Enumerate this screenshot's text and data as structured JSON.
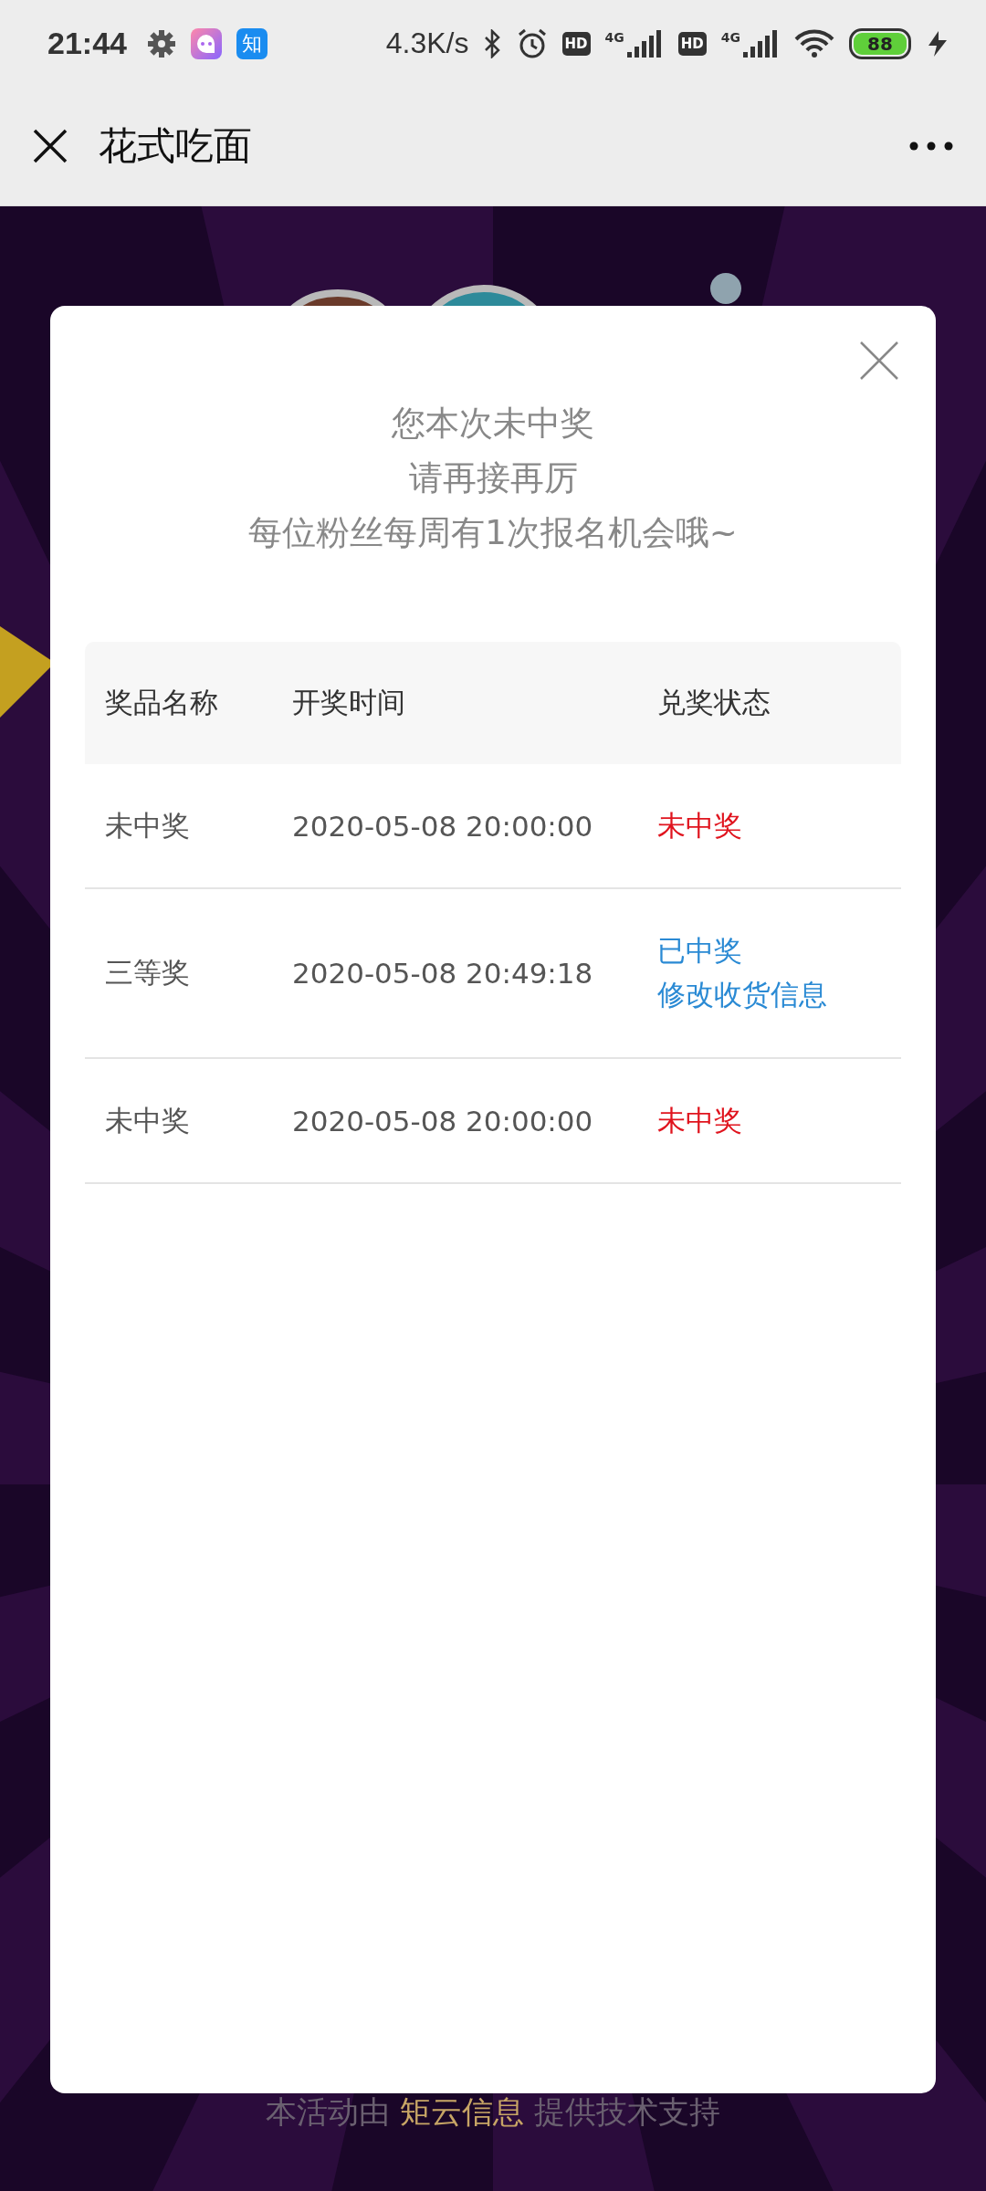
{
  "status_bar": {
    "time": "21:44",
    "app_badge": "知",
    "net_speed": "4.3K/s",
    "sims": [
      {
        "hd": "HD",
        "network": "4G"
      },
      {
        "hd": "HD",
        "network": "4G"
      }
    ],
    "battery": "88"
  },
  "header": {
    "title": "花式吃面"
  },
  "dialog": {
    "messages": [
      "您本次未中奖",
      "请再接再厉",
      "每位粉丝每周有1次报名机会哦~"
    ],
    "table": {
      "columns": [
        "奖品名称",
        "开奖时间",
        "兑奖状态"
      ],
      "rows": [
        {
          "prize": "未中奖",
          "time": "2020-05-08 20:00:00",
          "status": "未中奖",
          "kind": "lost"
        },
        {
          "prize": "三等奖",
          "time": "2020-05-08 20:49:18",
          "status": "已中奖",
          "link": "修改收货信息",
          "kind": "won"
        },
        {
          "prize": "未中奖",
          "time": "2020-05-08 20:00:00",
          "status": "未中奖",
          "kind": "lost"
        }
      ]
    }
  },
  "footer": {
    "before": "本活动由",
    "brand": "矩云信息",
    "after": "提供技术支持"
  }
}
